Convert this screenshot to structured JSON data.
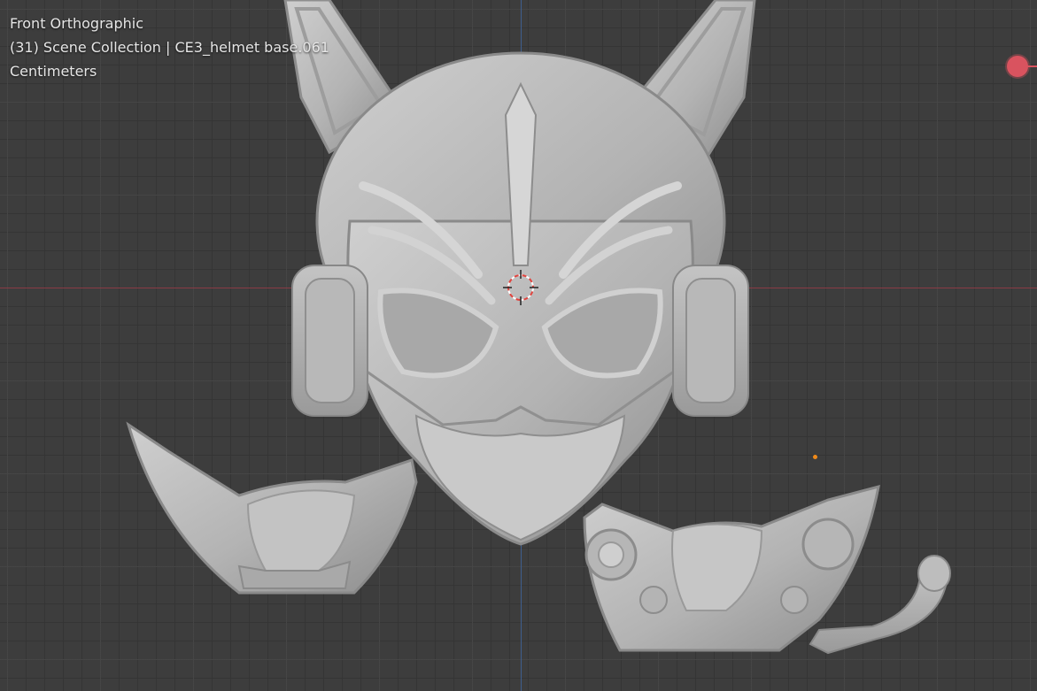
{
  "viewport": {
    "view_name": "Front Orthographic",
    "collection_line": "(31) Scene Collection | CE3_helmet base.061",
    "units": "Centimeters"
  },
  "colors": {
    "background": "#3d3d3d",
    "x_axis": "#8a3b45",
    "y_axis": "#3f5f8f",
    "gizmo_x": "#d9535f",
    "object_origin": "#f08a1a",
    "mesh": "#bdbdbd"
  },
  "icons": {
    "cursor": "3d-cursor-icon",
    "gizmo": "navigation-gizmo-x-icon",
    "origin": "object-origin-icon"
  }
}
